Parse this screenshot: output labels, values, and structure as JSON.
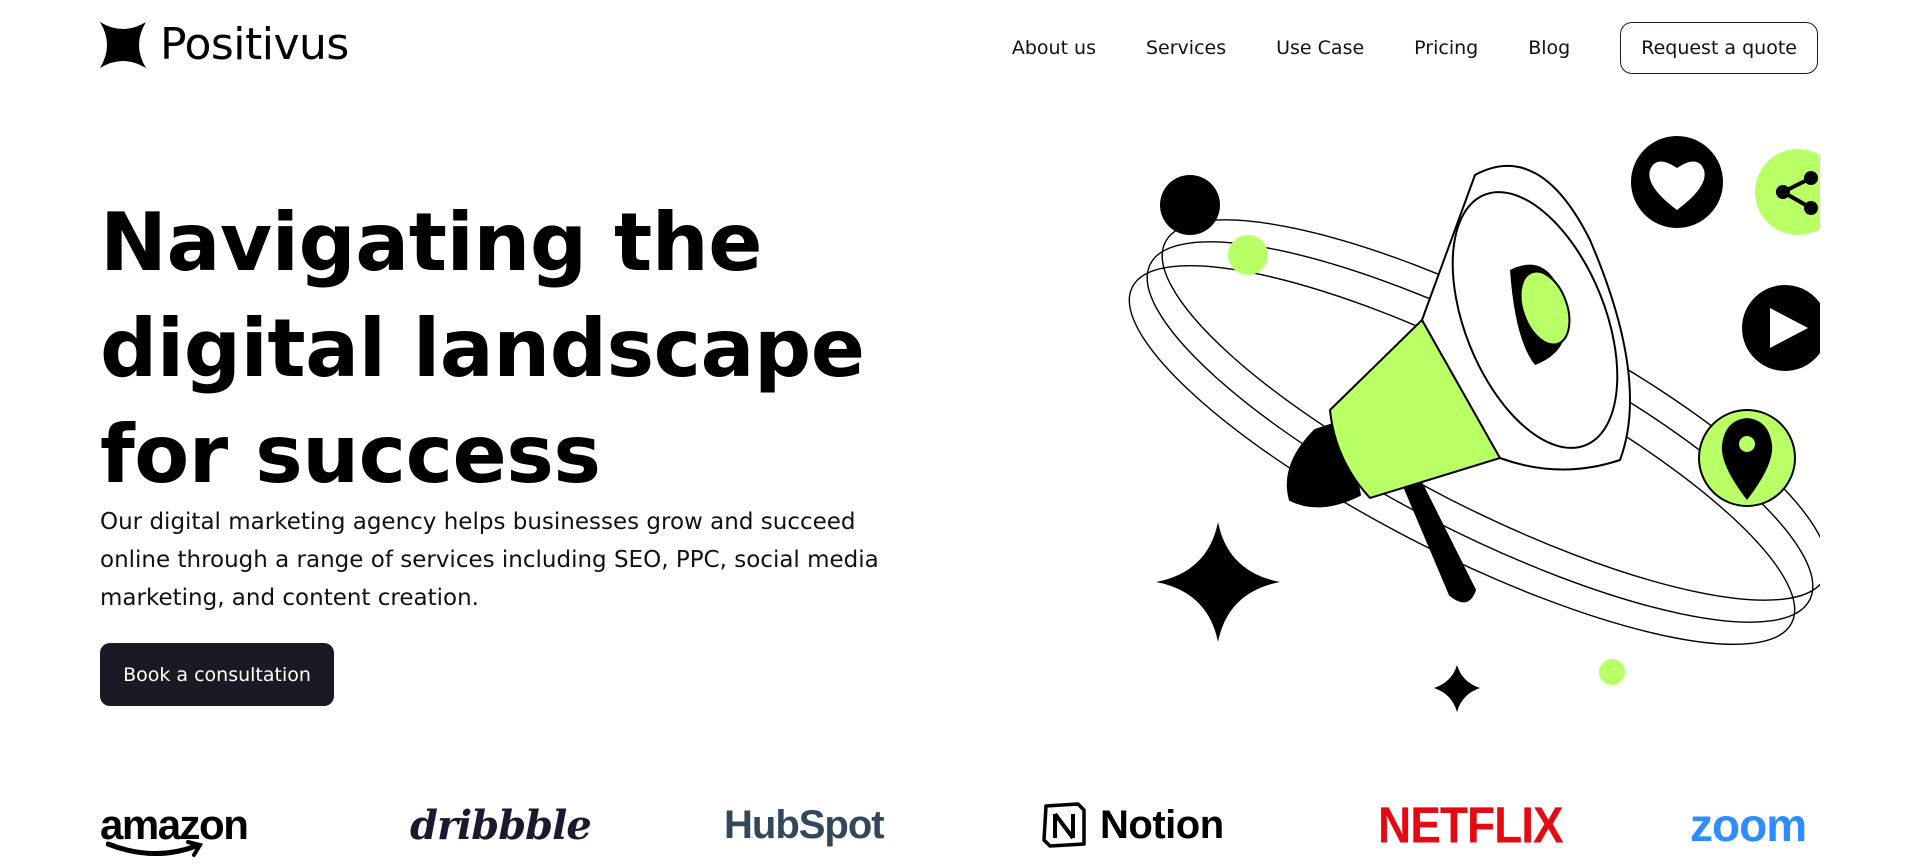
{
  "app": {
    "brand_name": "Positivus",
    "logo_icon": "star-sparkle-icon"
  },
  "nav": {
    "items": [
      {
        "label": "About us"
      },
      {
        "label": "Services"
      },
      {
        "label": "Use Case"
      },
      {
        "label": "Pricing"
      },
      {
        "label": "Blog"
      }
    ],
    "cta_label": "Request a quote"
  },
  "hero": {
    "title_lines": [
      "Navigating the",
      "digital landscape",
      "for success"
    ],
    "description": "Our digital marketing agency helps businesses grow and succeed online through a range of services including SEO, PPC, social media marketing, and content creation.",
    "cta_label": "Book a consultation",
    "illustration_icons": [
      "megaphone-icon",
      "heart-icon",
      "share-icon",
      "play-icon",
      "location-pin-icon",
      "sparkle-star-icon"
    ]
  },
  "brands": {
    "items": [
      {
        "name": "amazon",
        "color": "#000000"
      },
      {
        "name": "dribbble",
        "color": "#1a1a2e"
      },
      {
        "name": "HubSpot",
        "color": "#33475b"
      },
      {
        "name": "Notion",
        "color": "#000000"
      },
      {
        "name": "NETFLIX",
        "color": "#e50914"
      },
      {
        "name": "zoom",
        "color": "#2d8cff"
      }
    ]
  },
  "colors": {
    "accent": "#b9ff66",
    "dark": "#191a23",
    "background": "#ffffff"
  }
}
